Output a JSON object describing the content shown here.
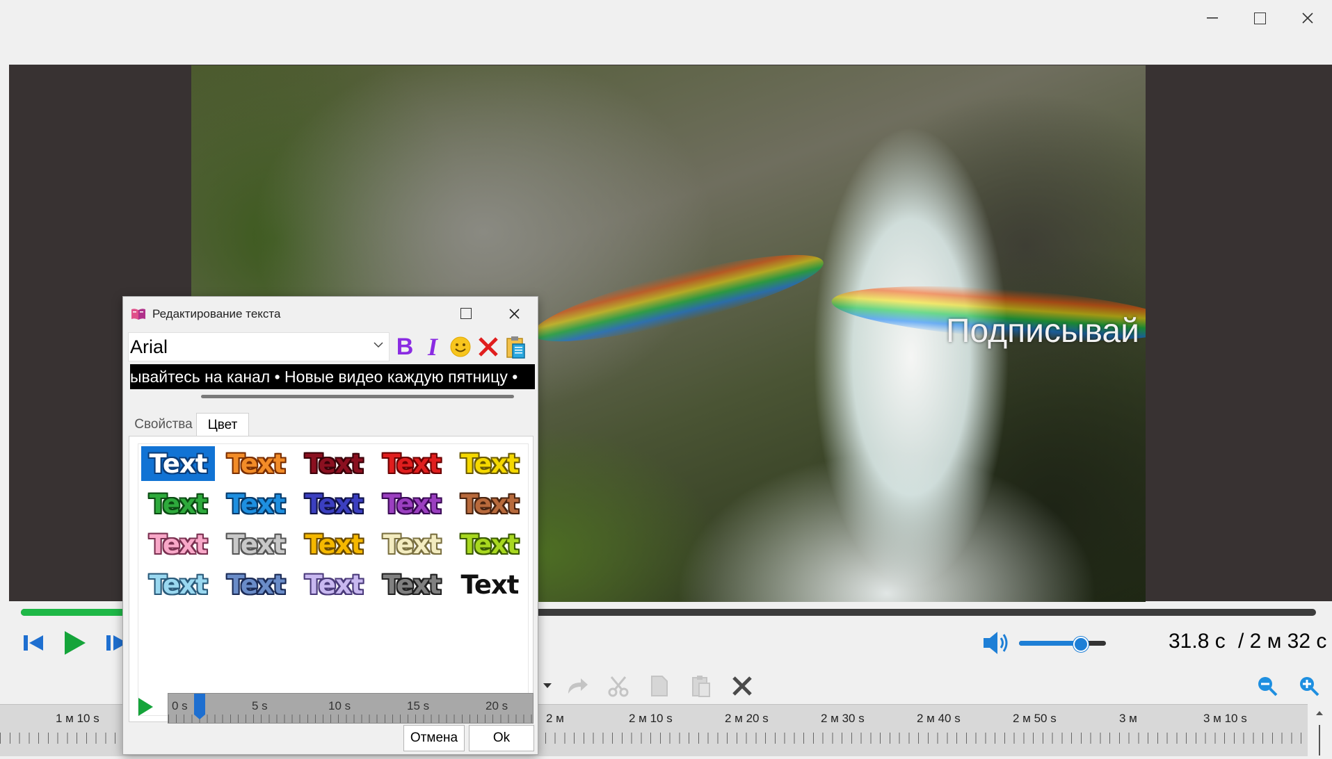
{
  "video": {
    "overlay_text": "Подписывай"
  },
  "player": {
    "progress_fraction": 0.21,
    "volume_fraction": 0.7,
    "time_current": "31.8 с",
    "time_total": "/ 2 м 32 с"
  },
  "timeline": {
    "labels": [
      "1 м 10 s",
      "2 м",
      "2 м 10 s",
      "2 м 20 s",
      "2 м 30 s",
      "2 м 40 s",
      "2 м 50 s",
      "3 м",
      "3 м 10 s"
    ]
  },
  "dialog": {
    "title": "Редактирование текста",
    "font": "Arial",
    "bold_label": "B",
    "italic_label": "I",
    "text_preview": "ывайтесь на канал • Новые видео каждую пятницу •",
    "tabs": [
      "Свойства",
      "Цвет"
    ],
    "active_tab": "Цвет",
    "styles": [
      {
        "label": "Text",
        "fill": "#ffffff",
        "stroke": "#0a3d7a",
        "selected": true
      },
      {
        "label": "Text",
        "fill": "#f28c28",
        "stroke": "#7a2e00"
      },
      {
        "label": "Text",
        "fill": "#8b1020",
        "stroke": "#3a0008"
      },
      {
        "label": "Text",
        "fill": "#e01e1e",
        "stroke": "#6a0000"
      },
      {
        "label": "Text",
        "fill": "#f5d800",
        "stroke": "#6a5a00"
      },
      {
        "label": "Text",
        "fill": "#2eaa3c",
        "stroke": "#0a4a12"
      },
      {
        "label": "Text",
        "fill": "#1e8fe0",
        "stroke": "#063a6a"
      },
      {
        "label": "Text",
        "fill": "#3b3fc0",
        "stroke": "#10124a"
      },
      {
        "label": "Text",
        "fill": "#9b3fc0",
        "stroke": "#3a0a55"
      },
      {
        "label": "Text",
        "fill": "#b86a3c",
        "stroke": "#4a2410"
      },
      {
        "label": "Text",
        "fill": "#f8a8c8",
        "stroke": "#7a3050"
      },
      {
        "label": "Text",
        "fill": "#c8c8c8",
        "stroke": "#555555"
      },
      {
        "label": "Text",
        "fill": "#f5b800",
        "stroke": "#6a4a00"
      },
      {
        "label": "Text",
        "fill": "#f3ecc0",
        "stroke": "#7a7040"
      },
      {
        "label": "Text",
        "fill": "#a8d820",
        "stroke": "#3a5a00"
      },
      {
        "label": "Text",
        "fill": "#9ad8f0",
        "stroke": "#2a5a7a"
      },
      {
        "label": "Text",
        "fill": "#6a8cc8",
        "stroke": "#1a2a55"
      },
      {
        "label": "Text",
        "fill": "#c8b8f0",
        "stroke": "#4a3a7a"
      },
      {
        "label": "Text",
        "fill": "#808080",
        "stroke": "#202020"
      },
      {
        "label": "Text",
        "fill": "#111111",
        "stroke": "#ffffff"
      }
    ],
    "mini_timeline_labels": [
      "0 s",
      "5 s",
      "10 s",
      "15 s",
      "20 s"
    ],
    "mini_marker_seconds": 1.4,
    "cancel_label": "Отмена",
    "ok_label": "Ok"
  },
  "colors": {
    "accent": "#1173d4",
    "progress": "#1fb847",
    "play_green": "#15a43a"
  }
}
